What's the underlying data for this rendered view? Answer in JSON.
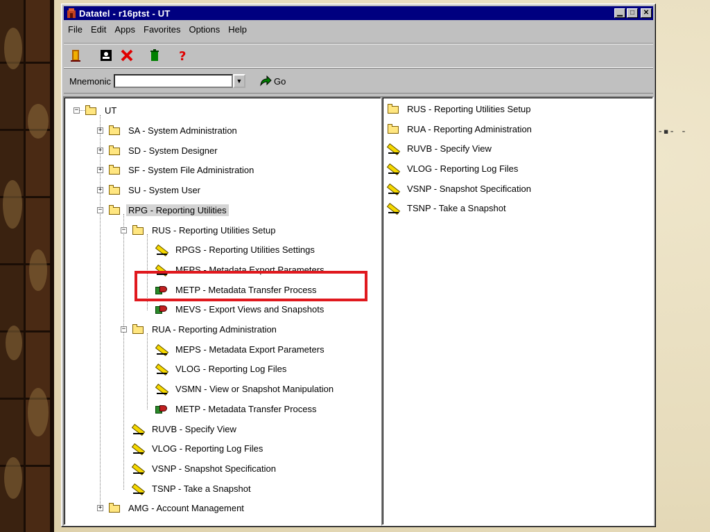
{
  "window": {
    "title": "Datatel - r16ptst - UT"
  },
  "menu": [
    {
      "label": "File"
    },
    {
      "label": "Edit"
    },
    {
      "label": "Apps"
    },
    {
      "label": "Favorites"
    },
    {
      "label": "Options"
    },
    {
      "label": "Help"
    }
  ],
  "mnemonic": {
    "label": "Mnemonic",
    "value": "",
    "go_label": "Go"
  },
  "tree": [
    {
      "label": "UT"
    },
    {
      "label": "SA - System Administration"
    },
    {
      "label": "SD - System Designer"
    },
    {
      "label": "SF - System File Administration"
    },
    {
      "label": "SU - System User"
    },
    {
      "label": "RPG - Reporting Utilities"
    },
    {
      "label": "RUS - Reporting Utilities Setup"
    },
    {
      "label": "RPGS - Reporting Utilities Settings"
    },
    {
      "label": "MEPS - Metadata Export Parameters"
    },
    {
      "label": "METP - Metadata Transfer Process"
    },
    {
      "label": "MEVS - Export Views and Snapshots"
    },
    {
      "label": "RUA - Reporting Administration"
    },
    {
      "label": "MEPS - Metadata Export Parameters"
    },
    {
      "label": "VLOG - Reporting Log Files"
    },
    {
      "label": "VSMN - View or Snapshot Manipulation"
    },
    {
      "label": "METP - Metadata Transfer Process"
    },
    {
      "label": "RUVB - Specify View"
    },
    {
      "label": "VLOG - Reporting Log Files"
    },
    {
      "label": "VSNP - Snapshot Specification"
    },
    {
      "label": "TSNP - Take a Snapshot"
    },
    {
      "label": "AMG - Account Management"
    }
  ],
  "list": [
    {
      "label": "RUS - Reporting Utilities Setup"
    },
    {
      "label": "RUA - Reporting Administration"
    },
    {
      "label": "RUVB - Specify View"
    },
    {
      "label": "VLOG - Reporting Log Files"
    },
    {
      "label": "VSNP - Snapshot Specification"
    },
    {
      "label": "TSNP - Take a Snapshot"
    }
  ]
}
